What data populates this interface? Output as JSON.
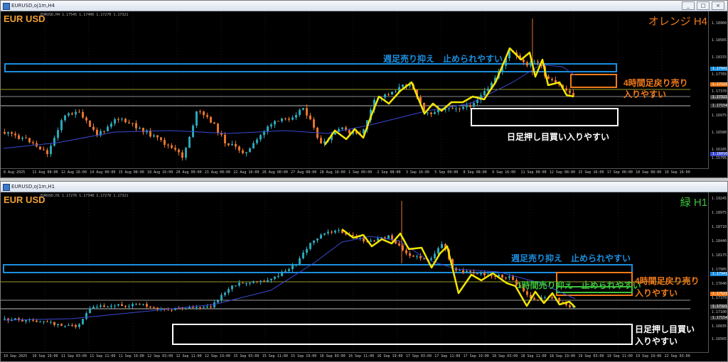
{
  "colors": {
    "bull": "#2aa6b8",
    "bear": "#e8742c",
    "ma": "#3a49d0",
    "zigzag": "#f2e600",
    "blue_zone": "#1a8fe0",
    "orange_zone": "#f07a1a",
    "white_zone": "#ffffff",
    "green_line": "#3cc33c",
    "olive_line": "#9a9a2a",
    "grid": "#3a3a3a"
  },
  "window_buttons": [
    "_",
    "□",
    "×"
  ],
  "top_window": {
    "title": "EURUSD,oj1m,H4",
    "symbol": "EUR USD",
    "ohlc": "EURUSD,H4 1.17545 1.17406 1.17270 1.17321",
    "corner_label": "オレンジ H4",
    "corner_color": "#f07a1a",
    "annotations": {
      "weekly_resistance": "週足売り抑え　止められやすい",
      "h4_pullback": [
        "4時間足戻り売り",
        "入りやすい"
      ],
      "daily_support": "日足押し目買い入りやすい"
    },
    "price_labels": [
      "1.18960",
      "1.18565",
      "1.18155",
      "1.17765",
      "1.17370",
      "1.16975",
      "1.16580",
      "1.16185",
      "1.15795"
    ],
    "price_badges": [
      {
        "text": "1.17941",
        "bg": "#1a8fe0"
      },
      {
        "text": "1.17523",
        "bg": "#f07a1a"
      },
      {
        "text": "1.17321",
        "bg": "#555555"
      },
      {
        "text": "1.17154",
        "bg": "#333333"
      },
      {
        "text": "1.16010",
        "bg": "#3a49d0"
      }
    ],
    "time_labels": [
      "8 Aug 2025",
      "11 Aug 08:00",
      "12 Aug 16:00",
      "14 Aug 00:00",
      "15 Aug 08:00",
      "18 Aug 16:00",
      "20 Aug 00:00",
      "21 Aug 08:00",
      "22 Aug 16:00",
      "26 Aug 00:00",
      "27 Aug 08:00",
      "28 Aug 16:00",
      "1 Sep 00:00",
      "2 Sep 08:00",
      "3 Sep 16:00",
      "5 Sep 00:00",
      "8 Sep 08:00",
      "9 Sep 16:00",
      "11 Sep 00:00",
      "12 Sep 08:00",
      "15 Sep 16:00",
      "17 Sep 00:00",
      "18 Sep 08:00",
      "19 Sep 16:00"
    ]
  },
  "bottom_window": {
    "title": "EURUSD,oj1m,H1",
    "symbol": "EUR USD",
    "ohlc": "EURUSD,H1 1.17276 1.17348 1.17276 1.17321",
    "corner_label": "緑 H1",
    "corner_color": "#3cc33c",
    "annotations": {
      "weekly_resistance": "週足売り抑え　止められやすい",
      "h1_resistance": "1時間売り抑え　止められやすい",
      "h4_pullback": [
        "4時間足戻り売り",
        "入りやすい"
      ],
      "daily_support": [
        "日足押し目買い",
        "入りやすい"
      ]
    },
    "price_labels": [
      "1.19245",
      "1.18975",
      "1.18710",
      "1.18440",
      "1.18175",
      "1.17905",
      "1.17640",
      "1.17370",
      "1.17100",
      "1.16835",
      "1.16565"
    ],
    "price_badges": [
      {
        "text": "1.17941",
        "bg": "#1a8fe0"
      },
      {
        "text": "1.17523",
        "bg": "#f07a1a"
      },
      {
        "text": "1.17321",
        "bg": "#555555"
      },
      {
        "text": "1.17154",
        "bg": "#333333"
      }
    ],
    "time_labels": [
      "10 Sep 2025",
      "10 Sep 19:00",
      "11 Sep 03:00",
      "11 Sep 11:00",
      "11 Sep 19:00",
      "12 Sep 03:00",
      "12 Sep 11:00",
      "12 Sep 19:00",
      "15 Sep 03:00",
      "15 Sep 11:00",
      "15 Sep 19:00",
      "16 Sep 03:00",
      "16 Sep 11:00",
      "16 Sep 19:00",
      "17 Sep 03:00",
      "17 Sep 11:00",
      "17 Sep 19:00",
      "18 Sep 03:00",
      "18 Sep 11:00",
      "18 Sep 19:00",
      "19 Sep 03:00",
      "19 Sep 11:00",
      "19 Sep 19:00",
      "22 Sep 03:00"
    ]
  }
}
